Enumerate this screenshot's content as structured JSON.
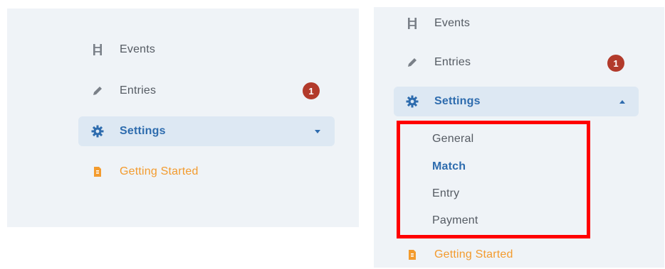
{
  "left_panel": {
    "nav": {
      "events_label": "Events",
      "entries_label": "Entries",
      "entries_badge": "1",
      "settings_label": "Settings",
      "getting_started_label": "Getting Started"
    }
  },
  "right_panel": {
    "nav": {
      "events_label": "Events",
      "entries_label": "Entries",
      "entries_badge": "1",
      "settings_label": "Settings",
      "getting_started_label": "Getting Started"
    },
    "settings_submenu": [
      {
        "label": "General"
      },
      {
        "label": "Match"
      },
      {
        "label": "Entry"
      },
      {
        "label": "Payment"
      }
    ],
    "selected_submenu_item": "Match"
  },
  "icons": {
    "events": "ladder-icon",
    "entries": "pencil-icon",
    "settings": "gear-icon",
    "getting_started": "document-icon",
    "collapsed": "caret-down-icon",
    "expanded": "caret-up-icon"
  },
  "colors": {
    "panel_bg": "#eff3f7",
    "active_bg": "#dde8f3",
    "active_text": "#2e6cae",
    "text": "#555b63",
    "badge": "#b23a2b",
    "getting_started": "#f39b2e",
    "highlight_box": "#ff0000"
  }
}
